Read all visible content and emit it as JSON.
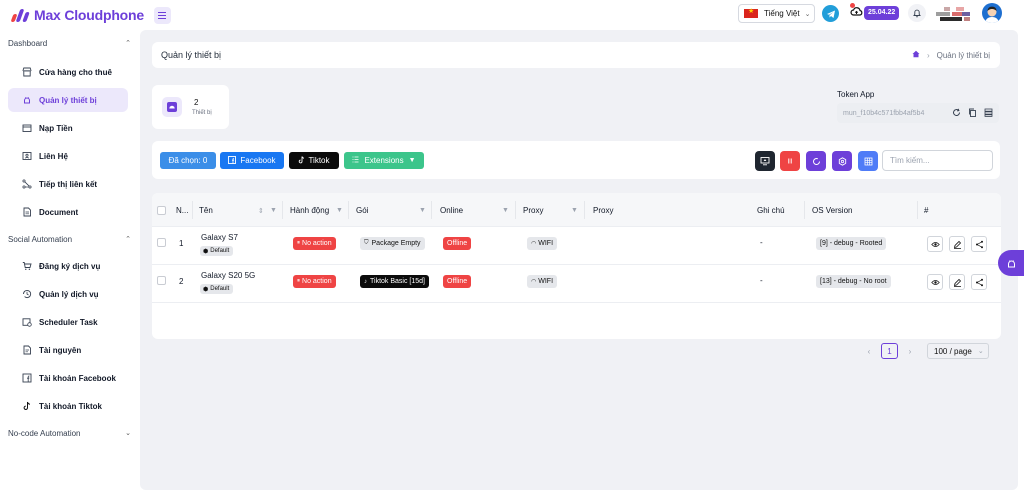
{
  "app": {
    "name": "Max Cloudphone"
  },
  "header": {
    "language": "Tiếng Việt",
    "date_badge": "25.04.22"
  },
  "sidebar": {
    "sections": [
      {
        "title": "Dashboard",
        "items": [
          {
            "label": "Cửa hàng cho thuê",
            "icon": "store-icon"
          },
          {
            "label": "Quản lý thiết bị",
            "icon": "android-icon",
            "active": true
          },
          {
            "label": "Nạp Tiền",
            "icon": "wallet-icon"
          },
          {
            "label": "Liên Hệ",
            "icon": "contact-card-icon"
          },
          {
            "label": "Tiếp thị liên kết",
            "icon": "share-nodes-icon"
          },
          {
            "label": "Document",
            "icon": "document-icon"
          }
        ]
      },
      {
        "title": "Social Automation",
        "items": [
          {
            "label": "Đăng ký dịch vụ",
            "icon": "cart-icon"
          },
          {
            "label": "Quản lý dịch vụ",
            "icon": "history-icon"
          },
          {
            "label": "Scheduler Task",
            "icon": "calendar-clock-icon"
          },
          {
            "label": "Tài nguyên",
            "icon": "file-icon"
          },
          {
            "label": "Tài khoản Facebook",
            "icon": "facebook-icon"
          },
          {
            "label": "Tài khoản Tiktok",
            "icon": "tiktok-icon"
          }
        ]
      },
      {
        "title": "No-code Automation",
        "items": []
      }
    ]
  },
  "page": {
    "title": "Quản lý thiết bị",
    "breadcrumb_current": "Quản lý thiết bị"
  },
  "stat": {
    "count": "2",
    "label": "Thiết bị"
  },
  "token": {
    "label": "Token App",
    "value": "mun_f10b4c571fbb4af5b4"
  },
  "toolbar": {
    "selected": "Đã chọn: 0",
    "facebook": "Facebook",
    "tiktok": "Tiktok",
    "extensions": "Extensions",
    "search_placeholder": "Tìm kiếm..."
  },
  "table": {
    "columns": {
      "no": "N...",
      "name": "Tên",
      "action": "Hành động",
      "package": "Gói",
      "online": "Online",
      "proxy1": "Proxy",
      "proxy2": "Proxy",
      "note": "Ghi chú",
      "os": "OS Version",
      "hash": "#"
    },
    "rows": [
      {
        "no": "1",
        "name": "Galaxy S7",
        "tag": "Default",
        "action": "No action",
        "package": "Package Empty",
        "online": "Offline",
        "proxy": "WIFI",
        "note": "-",
        "os": "[9] - debug - Rooted"
      },
      {
        "no": "2",
        "name": "Galaxy S20 5G",
        "tag": "Default",
        "action": "No action",
        "package": "Tiktok Basic [15d]",
        "online": "Offline",
        "proxy": "WIFI",
        "note": "-",
        "os": "[13] - debug - No root"
      }
    ]
  },
  "pagination": {
    "current": "1",
    "page_size": "100 / page"
  },
  "colors": {
    "brand": "#6d3fd9",
    "danger": "#ef4444",
    "facebook": "#1877f2",
    "extensions": "#3cc58b"
  }
}
